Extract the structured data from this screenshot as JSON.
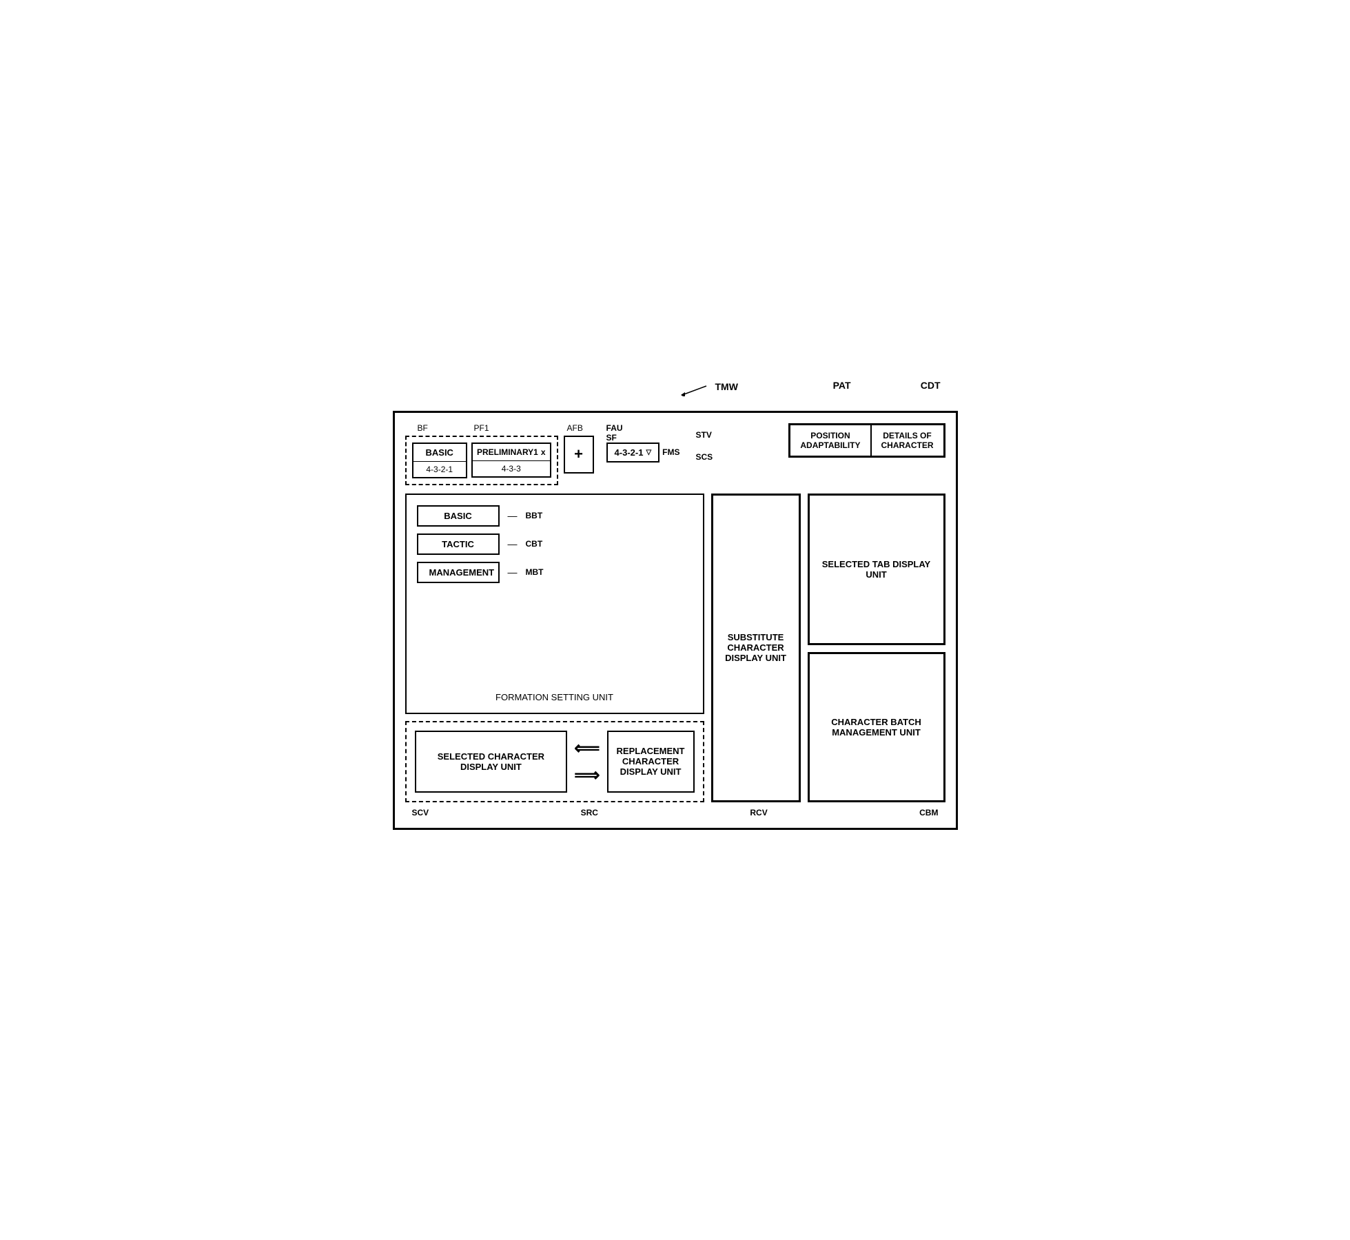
{
  "labels": {
    "tmw": "TMW",
    "pat": "PAT",
    "cdt": "CDT",
    "bf": "BF",
    "pf1": "PF1",
    "afb": "AFB",
    "fau": "FAU",
    "sf": "SF",
    "fms": "FMS",
    "stv": "STV",
    "scs": "SCS",
    "bbt": "BBT",
    "cbt": "CBT",
    "mbt": "MBT",
    "scv": "SCV",
    "src": "SRC",
    "rcv": "RCV",
    "cbm": "CBM"
  },
  "tabs": {
    "basic": "BASIC",
    "basic_code": "4-3-2-1",
    "preliminary1": "PRELIMINARY1",
    "preliminary1_code": "4-3-3",
    "plus": "+",
    "close": "x",
    "fms_value": "4-3-2-1",
    "triangle": "▽"
  },
  "top_right": {
    "position_adaptability": "POSITION\nADAPTABILITY",
    "details_of_character": "DETAILS OF\nCHARACTER"
  },
  "formation": {
    "title": "FORMATION SETTING UNIT",
    "basic_btn": "BASIC",
    "tactic_btn": "TACTIC",
    "management_btn": "MANAGEMENT"
  },
  "units": {
    "substitute_character": "SUBSTITUTE\nCHARACTER\nDISPLAY\nUNIT",
    "selected_tab": "SELECTED TAB\nDISPLAY UNIT",
    "character_batch": "CHARACTER BATCH\nMANAGEMENT UNIT",
    "selected_character": "SELECTED\nCHARACTER\nDISPLAY UNIT",
    "replacement_character": "REPLACEMENT\nCHARACTER\nDISPLAY UNIT"
  },
  "arrow_left": "⟸",
  "arrow_right": "⟹"
}
